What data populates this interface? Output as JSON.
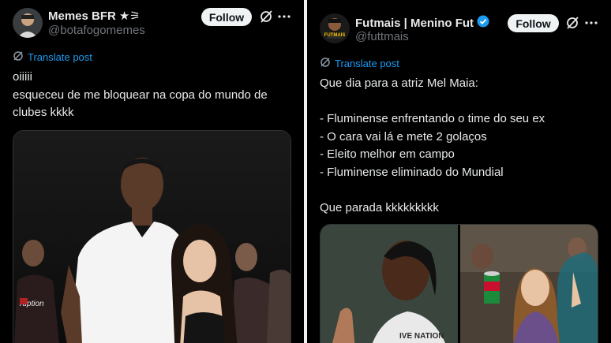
{
  "left_post": {
    "display_name": "Memes BFR",
    "name_badges": "★⚞",
    "handle": "@botafogomemes",
    "follow_label": "Follow",
    "translate_label": "Translate post",
    "text": "oiiiii\nesqueceu de me bloquear na copa do mundo de\nclubes kkkk",
    "image_caption_shirt_text": "ruption",
    "icons": [
      "grok-icon",
      "more-icon",
      "translate-icon"
    ]
  },
  "right_post": {
    "display_name": "Futmais | Menino Fut",
    "verified": true,
    "avatar_text": "FUTMAIS",
    "handle": "@futtmais",
    "follow_label": "Follow",
    "translate_label": "Translate post",
    "text": "Que dia para a atriz Mel Maia:\n\n- Fluminense enfrentando o time do seu ex\n- O cara vai lá e mete 2 golaços\n- Eleito melhor em campo\n- Fluminense eliminado do Mundial\n\nQue parada kkkkkkkkk",
    "image_shirt_text": "IVE NATION",
    "icons": [
      "grok-icon",
      "more-icon",
      "translate-icon",
      "verified-icon"
    ]
  },
  "colors": {
    "background": "#000000",
    "text": "#e7e9ea",
    "secondary": "#71767b",
    "link": "#1d9bf0",
    "follow_bg": "#eff3f4",
    "verified": "#1d9bf0"
  }
}
